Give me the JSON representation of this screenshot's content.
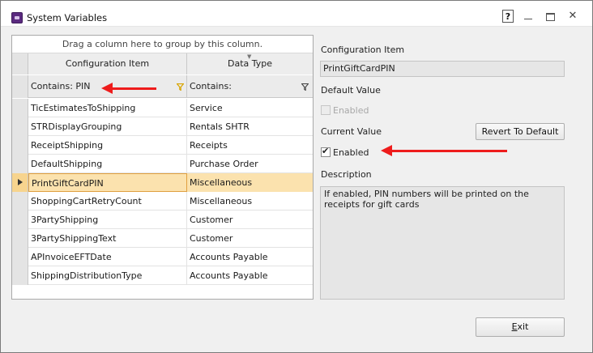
{
  "window": {
    "title": "System Variables",
    "help_label": "?",
    "close_glyph": "✕"
  },
  "grid": {
    "group_hint": "Drag a column here to group by this column.",
    "columns": [
      "Configuration Item",
      "Data Type"
    ],
    "filters": [
      "Contains: PIN",
      "Contains:"
    ],
    "rows": [
      {
        "item": "TicEstimatesToShipping",
        "type": "Service"
      },
      {
        "item": "STRDisplayGrouping",
        "type": "Rentals SHTR"
      },
      {
        "item": "ReceiptShipping",
        "type": "Receipts"
      },
      {
        "item": "DefaultShipping",
        "type": "Purchase Order"
      },
      {
        "item": "PrintGiftCardPIN",
        "type": "Miscellaneous"
      },
      {
        "item": "ShoppingCartRetryCount",
        "type": "Miscellaneous"
      },
      {
        "item": "3PartyShipping",
        "type": "Customer"
      },
      {
        "item": "3PartyShippingText",
        "type": "Customer"
      },
      {
        "item": "APInvoiceEFTDate",
        "type": "Accounts Payable"
      },
      {
        "item": "ShippingDistributionType",
        "type": "Accounts Payable"
      }
    ],
    "selected_index": 4
  },
  "details": {
    "config_item_label": "Configuration Item",
    "config_item_value": "PrintGiftCardPIN",
    "default_value_label": "Default Value",
    "default_enabled_label": "Enabled",
    "default_enabled_checked": false,
    "current_value_label": "Current Value",
    "revert_button_label": "Revert To Default",
    "current_enabled_label": "Enabled",
    "current_enabled_checked": true,
    "description_label": "Description",
    "description_text": "If enabled, PIN numbers will be printed on the receipts for gift cards"
  },
  "footer": {
    "exit_label": "Exit",
    "exit_mnemonic": "E",
    "exit_rest": "xit"
  },
  "colors": {
    "selected_row": "#fbe2ae",
    "annotation_arrow": "#ee1c1c",
    "filter_icon": "#d8a400",
    "app_icon": "#5b2a80"
  }
}
